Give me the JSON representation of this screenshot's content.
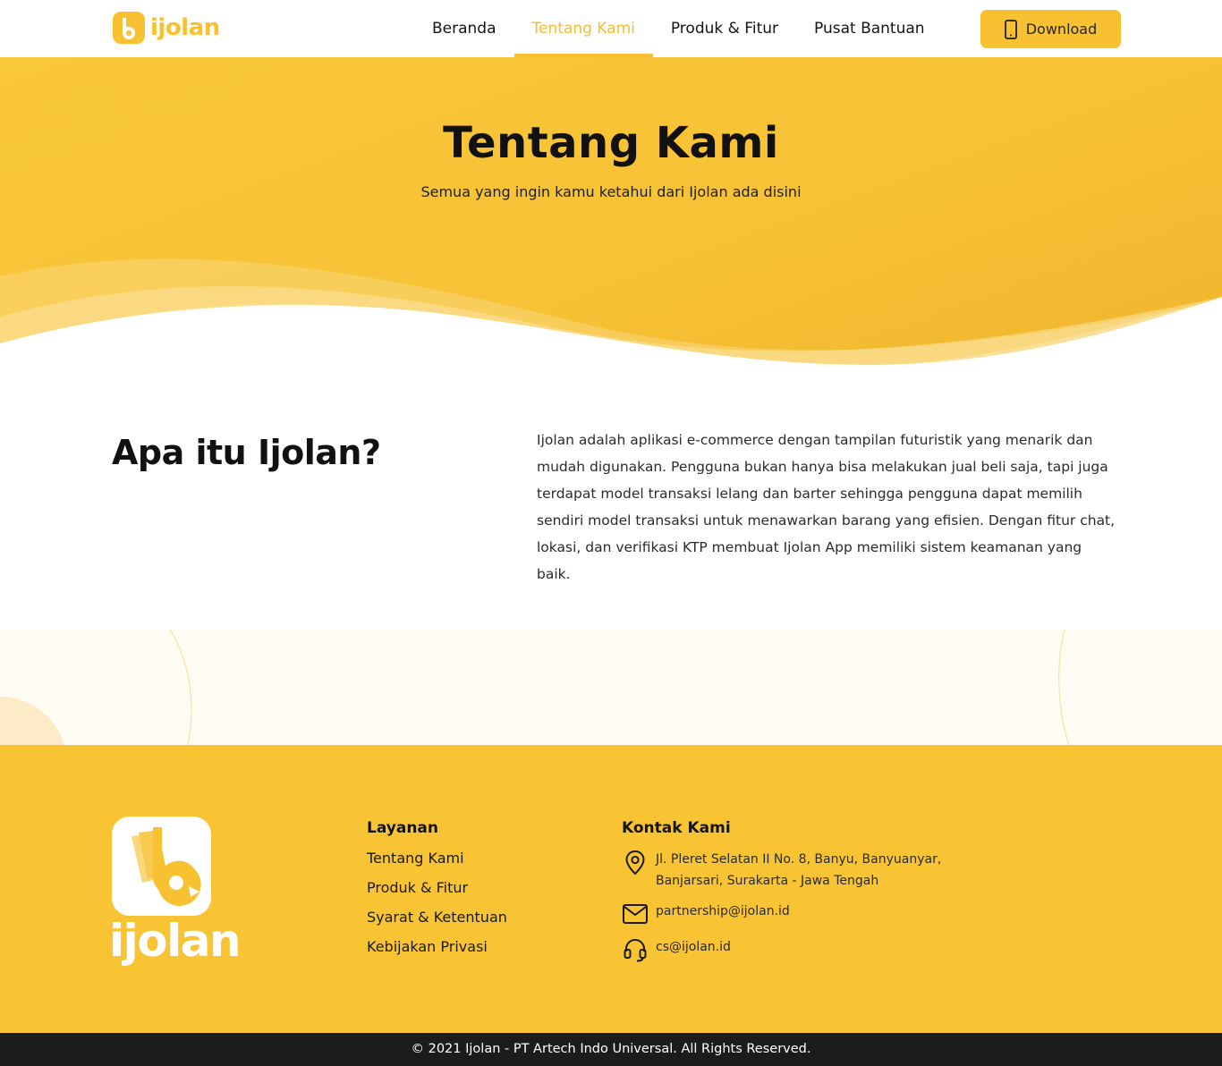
{
  "brand": {
    "name": "ijolan",
    "accent": "#f8c132",
    "dark": "#1c1c1c"
  },
  "nav": {
    "items": [
      {
        "label": "Beranda",
        "active": false
      },
      {
        "label": "Tentang Kami",
        "active": true
      },
      {
        "label": "Produk & Fitur",
        "active": false
      },
      {
        "label": "Pusat Bantuan",
        "active": false
      }
    ],
    "download_label": "Download",
    "download_icon": "smartphone-icon"
  },
  "hero": {
    "title": "Tentang Kami",
    "subtitle": "Semua yang ingin kamu ketahui dari Ijolan ada disini"
  },
  "about": {
    "title": "Apa itu Ijolan?",
    "body": "Ijolan adalah aplikasi e-commerce dengan tampilan futuristik yang menarik dan mudah digunakan. Pengguna bukan hanya bisa melakukan jual beli saja, tapi juga terdapat model transaksi lelang dan barter sehingga pengguna dapat memilih sendiri model transaksi untuk menawarkan barang yang efisien. Dengan fitur chat, lokasi, dan verifikasi KTP membuat Ijolan App memiliki sistem keamanan yang baik."
  },
  "footer": {
    "brand_name": "ijolan",
    "services": {
      "title": "Layanan",
      "links": [
        "Tentang Kami",
        "Produk & Fitur",
        "Syarat & Ketentuan",
        "Kebijakan Privasi"
      ]
    },
    "contact": {
      "title": "Kontak Kami",
      "address": "Jl. Pleret Selatan II No. 8, Banyu, Banyuanyar, Banjarsari, Surakarta - Jawa Tengah",
      "address_icon": "location-pin-icon",
      "email": "partnership@ijolan.id",
      "email_icon": "mail-icon",
      "support": "cs@ijolan.id",
      "support_icon": "headset-icon"
    },
    "copyright": "© 2021 Ijolan - PT Artech Indo Universal. All Rights Reserved."
  }
}
